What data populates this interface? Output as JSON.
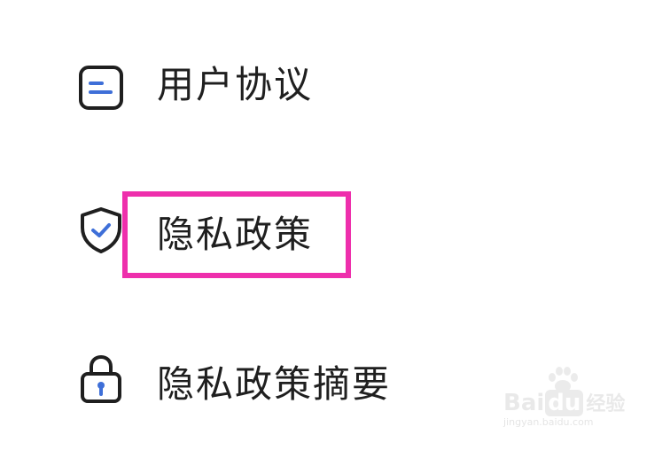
{
  "menu": {
    "items": [
      {
        "label": "用户协议",
        "icon": "document-icon"
      },
      {
        "label": "隐私政策",
        "icon": "shield-check-icon"
      },
      {
        "label": "隐私政策摘要",
        "icon": "lock-icon"
      }
    ]
  },
  "watermark": {
    "brand_prefix": "Bai",
    "brand_mark": "du",
    "brand_suffix": "经验",
    "url": "jingyan.baidu.com"
  },
  "colors": {
    "highlight": "#ee2fac",
    "icon_accent": "#3e6fd8",
    "icon_stroke": "#1f1f1f",
    "text": "#1f1f1f"
  }
}
